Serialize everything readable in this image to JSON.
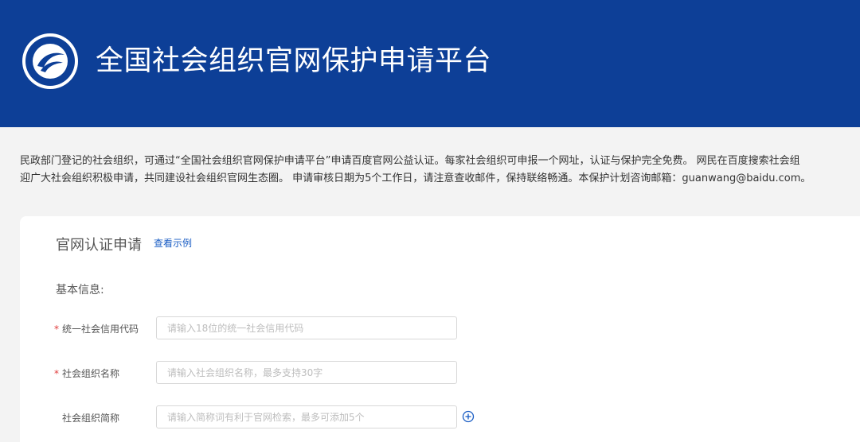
{
  "header": {
    "title": "全国社会组织官网保护申请平台",
    "logo_icon": "china-social-organization-emblem-icon",
    "background_color": "#0d3f97"
  },
  "intro": {
    "line1": "民政部门登记的社会组织，可通过“全国社会组织官网保护申请平台”申请百度官网公益认证。每家社会组织可申报一个网址，认证与保护完全免费。 网民在百度搜索社会组",
    "line2": "迎广大社会组织积极申请，共同建设社会组织官网生态圈。 申请审核日期为5个工作日，请注意查收邮件，保持联络畅通。本保护计划咨询邮箱：guanwang@baidu.com。"
  },
  "form": {
    "title": "官网认证申请",
    "example_link": "查看示例",
    "section_label": "基本信息:",
    "fields": [
      {
        "label": "统一社会信用代码",
        "required": true,
        "required_mark": "*",
        "placeholder": "请输入18位的统一社会信用代码",
        "value": ""
      },
      {
        "label": "社会组织名称",
        "required": true,
        "required_mark": "*",
        "placeholder": "请输入社会组织名称，最多支持30字",
        "value": ""
      },
      {
        "label": "社会组织简称",
        "required": false,
        "required_mark": "",
        "placeholder": "请输入简称词有利于官网检索，最多可添加5个",
        "value": "",
        "add_icon": "plus-circle-icon"
      }
    ],
    "accent_color": "#1a5dc4",
    "required_color": "#e03c3c"
  }
}
